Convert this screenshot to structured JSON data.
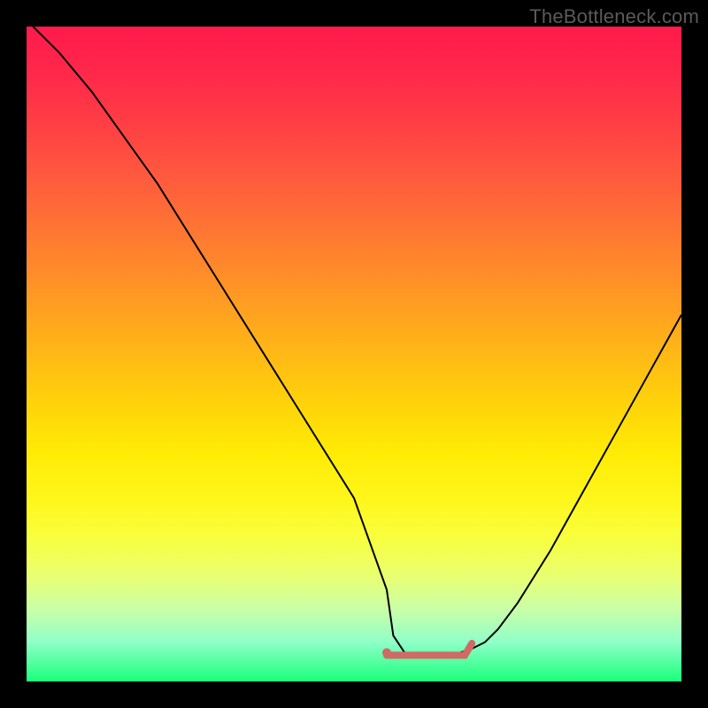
{
  "watermark": "TheBottleneck.com",
  "chart_data": {
    "type": "line",
    "title": "",
    "xlabel": "",
    "ylabel": "",
    "xlim": [
      0,
      100
    ],
    "ylim": [
      0,
      100
    ],
    "grid": false,
    "background": "heatmap-gradient",
    "gradient_colors": {
      "top": "#ff1a4b",
      "middle": "#ffe500",
      "bottom": "#1aff7a"
    },
    "series": [
      {
        "name": "curve",
        "color": "#000000",
        "width": 2,
        "x": [
          1,
          5,
          10,
          15,
          20,
          25,
          30,
          35,
          40,
          45,
          50,
          55,
          56,
          58,
          60,
          62,
          65,
          68,
          70,
          72,
          75,
          80,
          85,
          90,
          95,
          100
        ],
        "y": [
          100,
          96,
          90,
          83,
          76,
          68,
          60,
          52,
          44,
          36,
          28,
          14,
          7,
          4,
          4,
          4,
          4,
          5,
          6,
          8,
          12,
          20,
          29,
          38,
          47,
          56
        ]
      },
      {
        "name": "marker-segment",
        "color": "#d06a64",
        "type": "segment",
        "width": 8,
        "x": [
          55,
          68
        ],
        "y": [
          4,
          5
        ]
      },
      {
        "name": "marker-dot",
        "color": "#d06a64",
        "type": "point",
        "x": [
          55
        ],
        "y": [
          4
        ],
        "radius": 5
      }
    ]
  }
}
